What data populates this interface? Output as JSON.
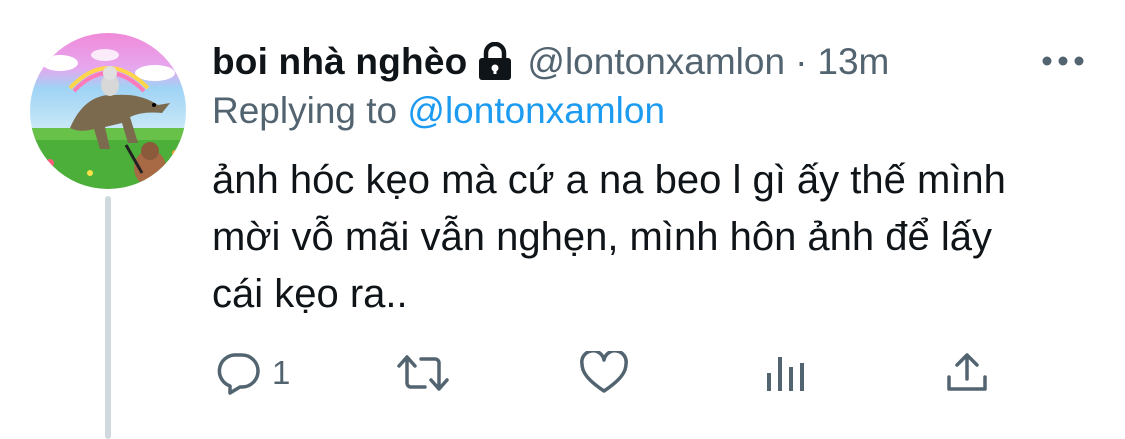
{
  "tweet": {
    "author": {
      "display_name": "boi nhà nghèo",
      "handle": "@lontonxamlon",
      "protected_icon": "lock-icon",
      "avatar": "avatar-image"
    },
    "separator": "·",
    "timestamp": "13m",
    "more_icon": "more-horizontal-icon",
    "replying_to": {
      "prefix": "Replying to ",
      "handle": "@lontonxamlon"
    },
    "text": "ảnh hóc kẹo mà cứ a na beo l gì ấy thế mình\nmời vỗ mãi vẫn nghẹn, mình hôn ảnh để lấy\ncái kẹo ra..",
    "actions": {
      "reply": {
        "icon": "reply-icon",
        "count": "1"
      },
      "retweet": {
        "icon": "retweet-icon",
        "count": ""
      },
      "like": {
        "icon": "heart-icon",
        "count": ""
      },
      "analytics": {
        "icon": "analytics-icon"
      },
      "share": {
        "icon": "share-icon"
      }
    }
  },
  "colors": {
    "primary_text": "#0f1419",
    "secondary_text": "#536471",
    "link": "#1d9bf0",
    "thread_line": "#cfd9de"
  }
}
